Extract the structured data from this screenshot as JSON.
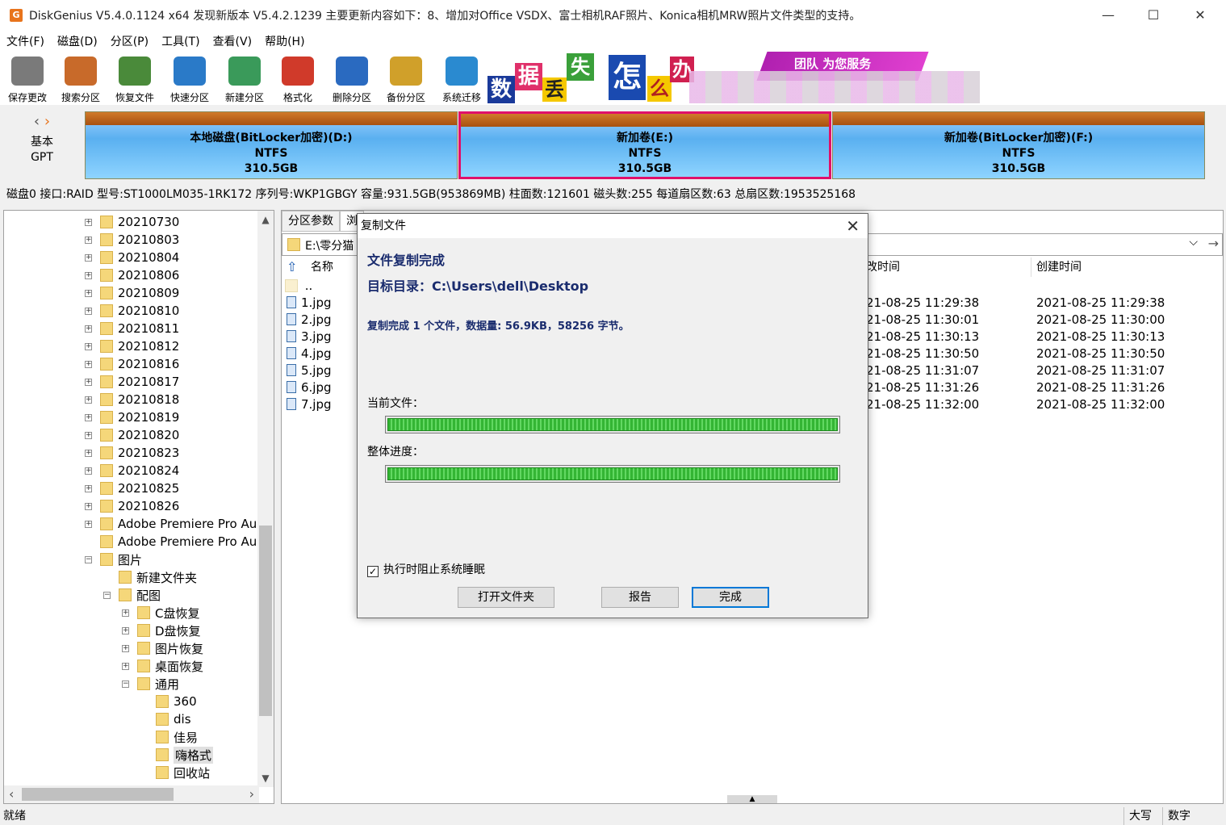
{
  "window": {
    "app_icon": "G",
    "title": "DiskGenius V5.4.0.1124 x64   发现新版本 V5.4.2.1239 主要更新内容如下：8、增加对Office VSDX、富士相机RAF照片、Konica相机MRW照片文件类型的支持。",
    "minimize": "—",
    "maximize": "☐",
    "close": "✕"
  },
  "menu": [
    "文件(F)",
    "磁盘(D)",
    "分区(P)",
    "工具(T)",
    "查看(V)",
    "帮助(H)"
  ],
  "toolbar": [
    {
      "label": "保存更改",
      "icon": "save-icon",
      "color": "#7a7a7a"
    },
    {
      "label": "搜索分区",
      "icon": "search-icon",
      "color": "#c86a2a"
    },
    {
      "label": "恢复文件",
      "icon": "recover-icon",
      "color": "#4a8a3a"
    },
    {
      "label": "快速分区",
      "icon": "quick-partition-icon",
      "color": "#2a7ac8"
    },
    {
      "label": "新建分区",
      "icon": "new-partition-icon",
      "color": "#3a9a5a"
    },
    {
      "label": "格式化",
      "icon": "format-icon",
      "color": "#d03a2a"
    },
    {
      "label": "删除分区",
      "icon": "delete-icon",
      "color": "#2a6ac0"
    },
    {
      "label": "备份分区",
      "icon": "backup-icon",
      "color": "#d0a02a"
    },
    {
      "label": "系统迁移",
      "icon": "migrate-icon",
      "color": "#2a8ad0"
    }
  ],
  "banner": {
    "chars": [
      "数",
      "据",
      "丢",
      "失",
      "怎",
      "么",
      "办"
    ],
    "slogan": "团队 为您服务"
  },
  "disk": {
    "type_label": "基本",
    "scheme": "GPT",
    "nav_left": "‹",
    "nav_right": "›",
    "partitions": [
      {
        "name": "本地磁盘(BitLocker加密)(D:)",
        "fs": "NTFS",
        "size": "310.5GB"
      },
      {
        "name": "新加卷(E:)",
        "fs": "NTFS",
        "size": "310.5GB"
      },
      {
        "name": "新加卷(BitLocker加密)(F:)",
        "fs": "NTFS",
        "size": "310.5GB"
      }
    ],
    "info": "磁盘0 接口:RAID  型号:ST1000LM035-1RK172  序列号:WKP1GBGY  容量:931.5GB(953869MB)  柱面数:121601  磁头数:255  每道扇区数:63  总扇区数:1953525168"
  },
  "tree": {
    "nodes": [
      {
        "label": "20210730",
        "level": 0,
        "exp": "+"
      },
      {
        "label": "20210803",
        "level": 0,
        "exp": "+"
      },
      {
        "label": "20210804",
        "level": 0,
        "exp": "+"
      },
      {
        "label": "20210806",
        "level": 0,
        "exp": "+"
      },
      {
        "label": "20210809",
        "level": 0,
        "exp": "+"
      },
      {
        "label": "20210810",
        "level": 0,
        "exp": "+"
      },
      {
        "label": "20210811",
        "level": 0,
        "exp": "+"
      },
      {
        "label": "20210812",
        "level": 0,
        "exp": "+"
      },
      {
        "label": "20210816",
        "level": 0,
        "exp": "+"
      },
      {
        "label": "20210817",
        "level": 0,
        "exp": "+"
      },
      {
        "label": "20210818",
        "level": 0,
        "exp": "+"
      },
      {
        "label": "20210819",
        "level": 0,
        "exp": "+"
      },
      {
        "label": "20210820",
        "level": 0,
        "exp": "+"
      },
      {
        "label": "20210823",
        "level": 0,
        "exp": "+"
      },
      {
        "label": "20210824",
        "level": 0,
        "exp": "+"
      },
      {
        "label": "20210825",
        "level": 0,
        "exp": "+"
      },
      {
        "label": "20210826",
        "level": 0,
        "exp": "+"
      },
      {
        "label": "Adobe Premiere Pro Au",
        "level": 0,
        "exp": "+"
      },
      {
        "label": "Adobe Premiere Pro Au",
        "level": 0,
        "exp": ""
      },
      {
        "label": "图片",
        "level": 0,
        "exp": "−"
      },
      {
        "label": "新建文件夹",
        "level": 1,
        "exp": ""
      },
      {
        "label": "配图",
        "level": 1,
        "exp": "−"
      },
      {
        "label": "C盘恢复",
        "level": 2,
        "exp": "+"
      },
      {
        "label": "D盘恢复",
        "level": 2,
        "exp": "+"
      },
      {
        "label": "图片恢复",
        "level": 2,
        "exp": "+"
      },
      {
        "label": "桌面恢复",
        "level": 2,
        "exp": "+"
      },
      {
        "label": "通用",
        "level": 2,
        "exp": "−"
      },
      {
        "label": "360",
        "level": 3,
        "exp": ""
      },
      {
        "label": "dis",
        "level": 3,
        "exp": ""
      },
      {
        "label": "佳易",
        "level": 3,
        "exp": ""
      },
      {
        "label": "嗨格式",
        "level": 3,
        "exp": "",
        "selected": true
      },
      {
        "label": "回收站",
        "level": 3,
        "exp": ""
      }
    ],
    "scroll_up": "▲",
    "scroll_down": "▼",
    "scroll_left": "‹",
    "scroll_right": "›"
  },
  "browser": {
    "tabs": [
      "分区参数",
      "浏"
    ],
    "path": "E:\\零分猫",
    "path_dropdown": "⌵",
    "path_go": "→",
    "col_name": "名称",
    "col_modified": "改时间",
    "col_created": "创建时间",
    "up_icon": "⇧",
    "parent_dir": "..",
    "files": [
      {
        "name": "1.jpg",
        "modified": "21-08-25 11:29:38",
        "created": "2021-08-25 11:29:38"
      },
      {
        "name": "2.jpg",
        "modified": "21-08-25 11:30:01",
        "created": "2021-08-25 11:30:00"
      },
      {
        "name": "3.jpg",
        "modified": "21-08-25 11:30:13",
        "created": "2021-08-25 11:30:13"
      },
      {
        "name": "4.jpg",
        "modified": "21-08-25 11:30:50",
        "created": "2021-08-25 11:30:50"
      },
      {
        "name": "5.jpg",
        "modified": "21-08-25 11:31:07",
        "created": "2021-08-25 11:31:07"
      },
      {
        "name": "6.jpg",
        "modified": "21-08-25 11:31:26",
        "created": "2021-08-25 11:31:26"
      },
      {
        "name": "7.jpg",
        "modified": "21-08-25 11:32:00",
        "created": "2021-08-25 11:32:00"
      }
    ],
    "splitter_arrow": "▲"
  },
  "dialog": {
    "title": "复制文件",
    "close": "✕",
    "heading": "文件复制完成",
    "target_dir": "目标目录：C:\\Users\\dell\\Desktop",
    "summary": "复制完成 1 个文件，数据量: 56.9KB，58256 字节。",
    "current_file_label": "当前文件：",
    "current_progress": 1.0,
    "overall_label": "整体进度：",
    "overall_progress": 1.0,
    "checkbox_label": "执行时阻止系统睡眠",
    "checkbox_mark": "✓",
    "btn_open": "打开文件夹",
    "btn_report": "报告",
    "btn_done": "完成"
  },
  "status": {
    "text": "就绪",
    "caps": "大写",
    "num": "数字"
  }
}
